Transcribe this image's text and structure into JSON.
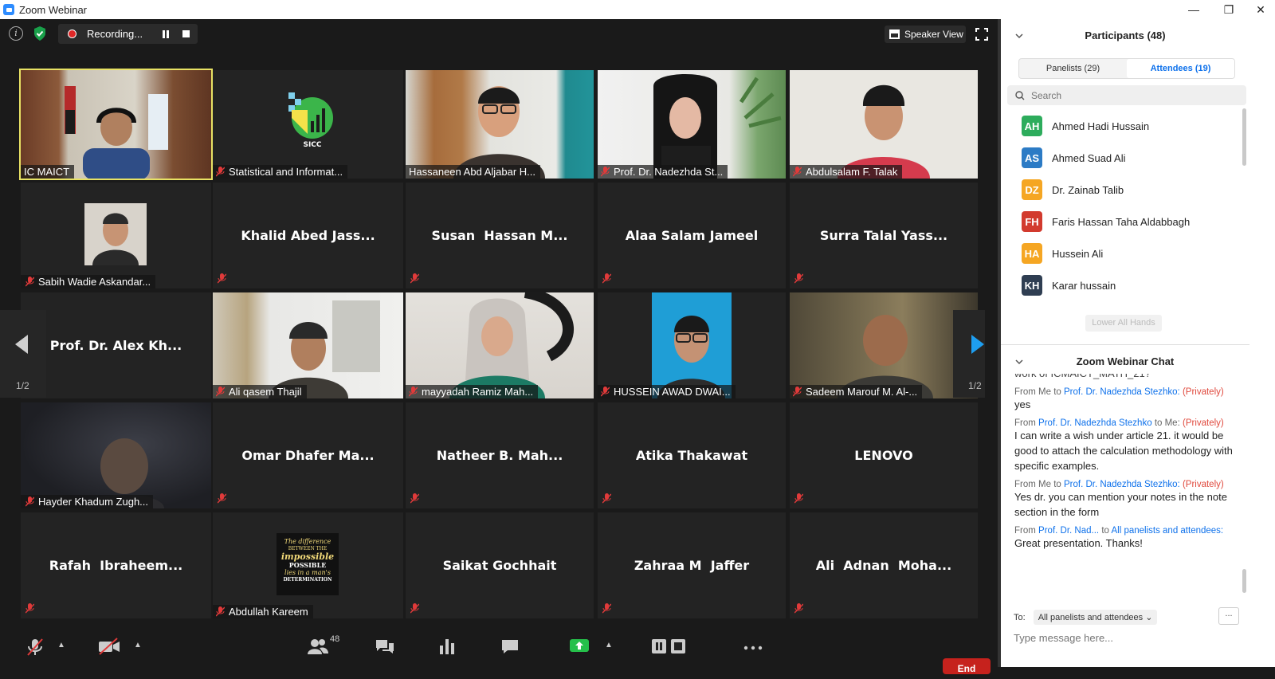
{
  "window": {
    "title": "Zoom Webinar",
    "minimize": "—",
    "restore": "❐",
    "close": "✕"
  },
  "topbar": {
    "recording_label": "Recording...",
    "speaker_view_label": "Speaker View"
  },
  "nav": {
    "page_left": "1/2",
    "page_right": "1/2"
  },
  "tiles": {
    "r1c1": "IC MAICT",
    "r1c2": "Statistical and Informat...",
    "r1c2_logo_text": "SICC",
    "r1c3": "Hassaneen Abd Aljabar H...",
    "r1c4": "Prof. Dr. Nadezhda St...",
    "r1c5": "Abdulsalam F. Talak",
    "r2c1": "Sabih Wadie Askandar...",
    "r2c2": "Khalid Abed Jass...",
    "r2c3": "Susan  Hassan M...",
    "r2c4": "Alaa Salam Jameel",
    "r2c5": "Surra Talal Yass...",
    "r3c1": "Prof. Dr. Alex Kh...",
    "r3c2": "Ali qasem Thajil",
    "r3c3": "mayyadah Ramiz Mah...",
    "r3c4": "HUSSEIN AWAD DWAI...",
    "r3c5": "Sadeem Marouf M. Al-...",
    "r4c1": "Hayder Khadum Zugh...",
    "r4c2": "Omar Dhafer Ma...",
    "r4c3": "Natheer B. Mah...",
    "r4c4": "Atika Thakawat",
    "r4c5": "LENOVO",
    "r5c1": "Rafah  Ibraheem...",
    "r5c2": "Abdullah Kareem",
    "r5c2_poster": [
      "The difference",
      "BETWEEN THE",
      "impossible",
      "POSSIBLE",
      "lies in a man's",
      "DETERMINATION"
    ],
    "r5c3": "Saikat Gochhait",
    "r5c4": "Zahraa M  Jaffer",
    "r5c5": "Ali  Adnan  Moha..."
  },
  "toolbar": {
    "participants_count": "48",
    "end_label": "End"
  },
  "participants": {
    "header": "Participants (48)",
    "tabs": [
      "Panelists (29)",
      "Attendees (19)"
    ],
    "search_placeholder": "Search",
    "list": [
      {
        "initials": "AH",
        "name": "Ahmed Hadi Hussain",
        "color": "#2dac5c"
      },
      {
        "initials": "AS",
        "name": "Ahmed Suad Ali",
        "color": "#2c7bc5"
      },
      {
        "initials": "DZ",
        "name": "Dr. Zainab Talib",
        "color": "#f5a623"
      },
      {
        "initials": "FH",
        "name": "Faris Hassan Taha Aldabbagh",
        "color": "#d23a2e"
      },
      {
        "initials": "HA",
        "name": "Hussein Ali",
        "color": "#f5a623"
      },
      {
        "initials": "KH",
        "name": "Karar hussain",
        "color": "#2f3e52"
      }
    ],
    "lower_hands": "Lower All Hands"
  },
  "chat": {
    "header": "Zoom Webinar Chat",
    "cut_line": "work of ICMAICT_MATH_21?",
    "messages": [
      {
        "from": "From Me",
        "to_word": "to",
        "to": "Prof. Dr. Nadezhda Stezhko:",
        "priv": "(Privately)",
        "text": "yes"
      },
      {
        "from": "From",
        "from_name": "Prof. Dr. Nadezhda Stezhko",
        "to_word": "to Me:",
        "priv": "(Privately)",
        "text": "I can write a wish under article 21. it would be good to attach the calculation methodology with specific examples."
      },
      {
        "from": "From Me",
        "to_word": "to",
        "to": "Prof. Dr. Nadezhda Stezhko:",
        "priv": "(Privately)",
        "text": "Yes dr. you can mention your notes in the note section in the form"
      },
      {
        "from": "From",
        "from_name": "Prof. Dr. Nad...",
        "to_word": "to",
        "to": "All panelists and attendees:",
        "text": "Great presentation. Thanks!"
      }
    ],
    "to_label": "To:",
    "to_value": "All panelists and attendees ⌄",
    "more": "...",
    "input_placeholder": "Type message here..."
  }
}
